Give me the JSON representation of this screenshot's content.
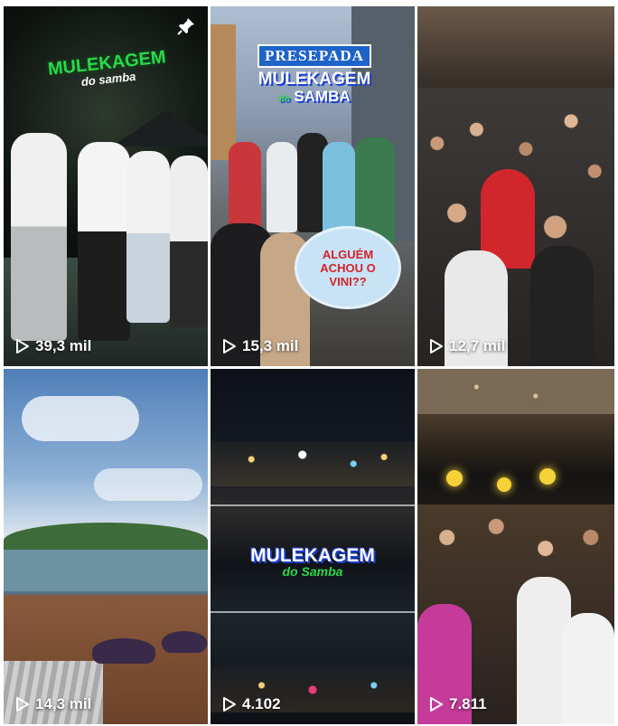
{
  "tiles": [
    {
      "views": "39,3 mil",
      "title_main": "MULEKAGEM",
      "title_sub": "do samba",
      "pinned": true
    },
    {
      "views": "15,3 mil",
      "banner": "PRESEPADA",
      "title_main": "MULEKAGEM",
      "title_sub": "SAMBA",
      "title_join": "do",
      "bubble": "ALGUÉM ACHOU O VINI??"
    },
    {
      "views": "12,7 mil"
    },
    {
      "views": "14,3 mil"
    },
    {
      "views": "4.102",
      "title_main": "MULEKAGEM",
      "title_sub": "do Samba"
    },
    {
      "views": "7.811"
    }
  ],
  "icons": {
    "pin": "pin-icon",
    "play": "play-icon"
  },
  "colors": {
    "green": "#2bd84a",
    "blue": "#1a3fd1",
    "white": "#ffffff"
  }
}
